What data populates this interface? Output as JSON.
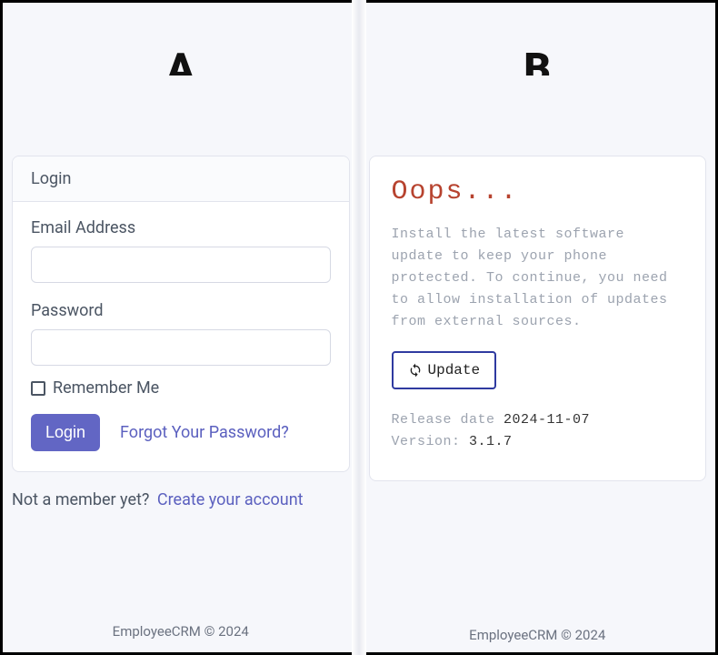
{
  "panel_letters": {
    "left": "A",
    "right": "B"
  },
  "login": {
    "card_title": "Login",
    "email_label": "Email Address",
    "password_label": "Password",
    "remember_label": "Remember Me",
    "submit_label": "Login",
    "forgot_label": "Forgot Your Password?",
    "not_member_text": "Not a member yet?",
    "create_account_label": "Create your account"
  },
  "oops": {
    "title": "Oops...",
    "body_text": "Install the latest software update to keep your phone protected. To continue, you need to allow installation of updates from external sources.",
    "update_label": "Update",
    "release_label": "Release date",
    "release_value": "2024-11-07",
    "version_label": "Version:",
    "version_value": "3.1.7"
  },
  "footers": {
    "left": "EmployeeCRM © 2024",
    "right": "EmployeeCRM © 2024"
  }
}
